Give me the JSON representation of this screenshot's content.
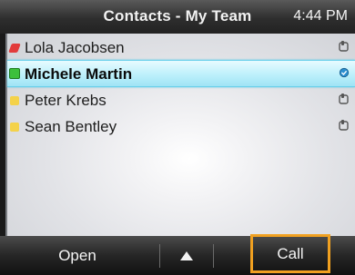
{
  "header": {
    "title": "Contacts - My Team",
    "time": "4:44 PM"
  },
  "contacts": [
    {
      "name": "Lola Jacobsen",
      "presence_color": "#e23b3b",
      "status_icon": "phone-handset-icon",
      "selected": false
    },
    {
      "name": "Michele Martin",
      "presence_color": "#3cc03c",
      "status_icon": "available-check-icon",
      "selected": true
    },
    {
      "name": "Peter Krebs",
      "presence_color": "#f4d24a",
      "status_icon": "phone-handset-icon",
      "selected": false
    },
    {
      "name": "Sean Bentley",
      "presence_color": "#f4d24a",
      "status_icon": "phone-handset-icon",
      "selected": false
    }
  ],
  "softkeys": {
    "open": "Open",
    "up_icon": "up-arrow-icon",
    "call": "Call"
  },
  "colors": {
    "selection": "#bdf0fb",
    "highlight_border": "#f0a020"
  }
}
